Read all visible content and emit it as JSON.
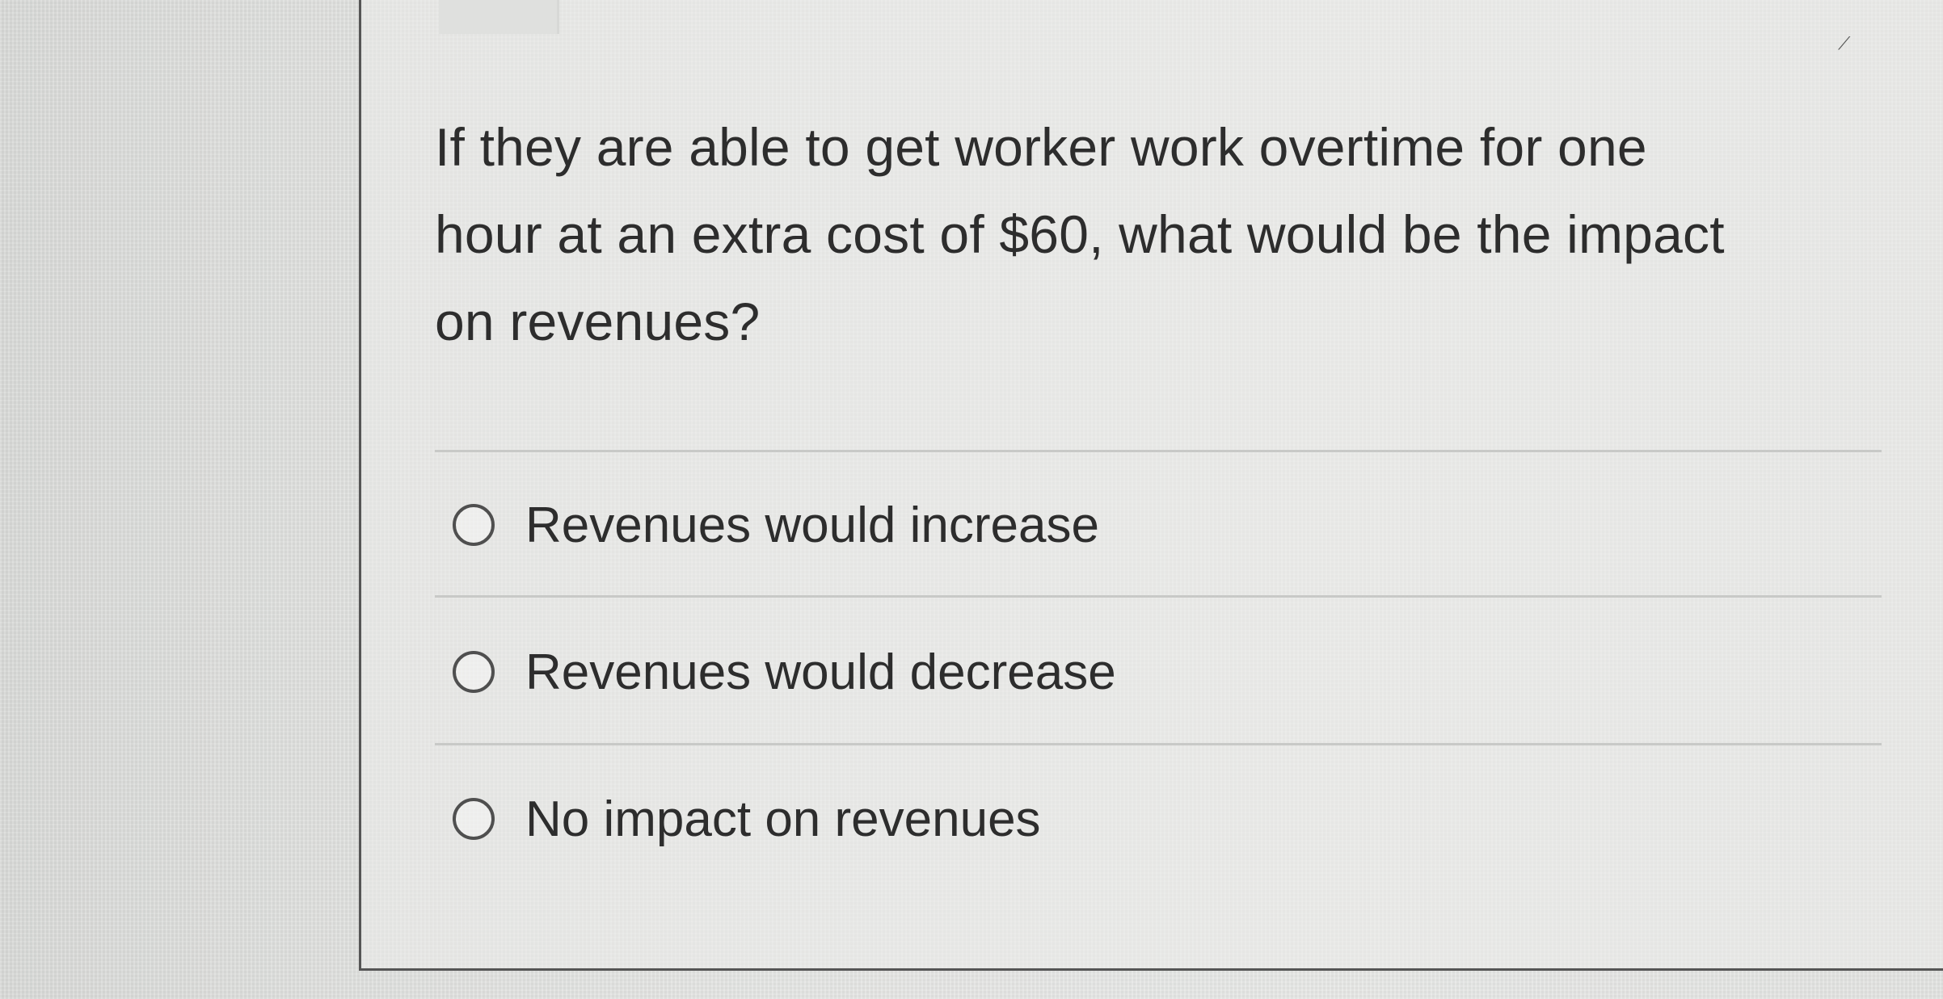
{
  "question": {
    "line_1": "If they are able to get worker work overtime for one",
    "line_2": "hour at an extra cost of $60, what would be the impact",
    "line_3": "on revenues?"
  },
  "options": [
    {
      "label": "Revenues would increase",
      "selected": false
    },
    {
      "label": "Revenues would decrease",
      "selected": false
    },
    {
      "label": "No impact on revenues",
      "selected": false
    }
  ],
  "icons": {
    "resize": "resize-handle-icon",
    "radio": "radio-button-icon"
  },
  "colors": {
    "text": "#2d2d2d",
    "border": "#555555",
    "divider": "#c8c9c7"
  }
}
